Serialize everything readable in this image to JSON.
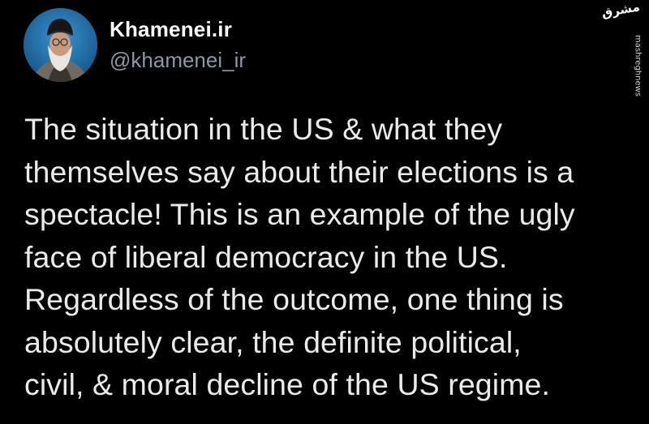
{
  "author": {
    "display_name": "Khamenei.ir",
    "handle": "@khamenei_ir",
    "avatar_icon": "profile-photo"
  },
  "tweet": {
    "lines": [
      "The situation in the US & what they",
      "themselves say about their elections is a",
      "spectacle! This is an example of the ugly",
      "face of liberal democracy in the US.",
      "Regardless of the outcome, one thing is",
      "absolutely clear, the definite political,",
      "civil, & moral decline of the US regime."
    ]
  },
  "watermark": {
    "logo_text": "مشرق",
    "site": "mashreghnews"
  },
  "colors": {
    "background": "#000000",
    "text": "#e9eaeb",
    "handle": "#8b98a5"
  }
}
